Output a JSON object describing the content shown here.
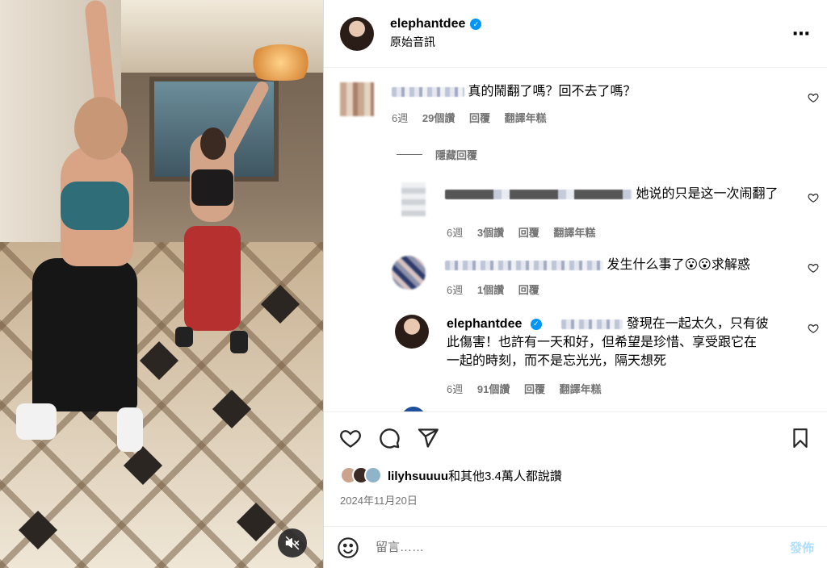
{
  "post": {
    "username": "elephantdee",
    "audio": "原始音訊",
    "more_icon": "⋯",
    "verified_icon": "✓"
  },
  "comments": [
    {
      "text": "真的鬧翻了嗎？回不去了嗎？",
      "time": "6週",
      "likes": "29個讚",
      "reply": "回覆",
      "translate": "翻譯年糕",
      "hide_replies": "隱藏回覆"
    },
    {
      "text": "她说的只是这一次闹翻了",
      "time": "6週",
      "likes": "3個讚",
      "reply": "回覆",
      "translate": "翻譯年糕"
    },
    {
      "text": "发生什么事了😮😮求解惑",
      "time": "6週",
      "likes": "1個讚",
      "reply": "回覆"
    },
    {
      "username": "elephantdee",
      "text_line1": "發現在一起太久，只有彼",
      "text_line2": "此傷害！也許有一天和好，但希望是珍惜、享受跟它在",
      "text_line3": "一起的時刻，而不是忘光光，隔天想死",
      "time": "6週",
      "likes": "91個讚",
      "reply": "回覆",
      "translate": "翻譯年糕"
    }
  ],
  "likes_line": {
    "user": "lilyhsuuuu",
    "rest": "和其他3.4萬人都說讚"
  },
  "date": "2024年11月20日",
  "composer": {
    "placeholder": "留言……",
    "post_label": "發佈"
  },
  "colors": {
    "verified": "#0095f6",
    "meta": "#737373",
    "post_button": "#b2dffc"
  }
}
